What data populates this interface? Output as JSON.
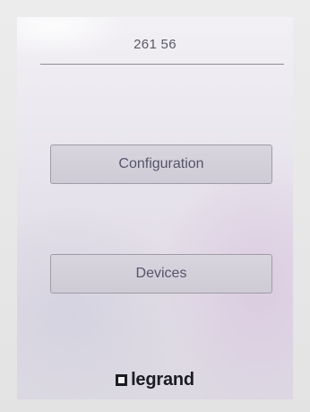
{
  "screen": {
    "header_value": "261 56"
  },
  "menu": {
    "items": [
      {
        "label": "Configuration"
      },
      {
        "label": "Devices"
      }
    ]
  },
  "brand": {
    "logo_text": "legrand"
  },
  "colors": {
    "screen_background": "#e6e3ea",
    "button_fill": "#d4d0da",
    "button_border": "#9f9ba7",
    "text": "#56546a",
    "logo": "#1c1c22"
  }
}
